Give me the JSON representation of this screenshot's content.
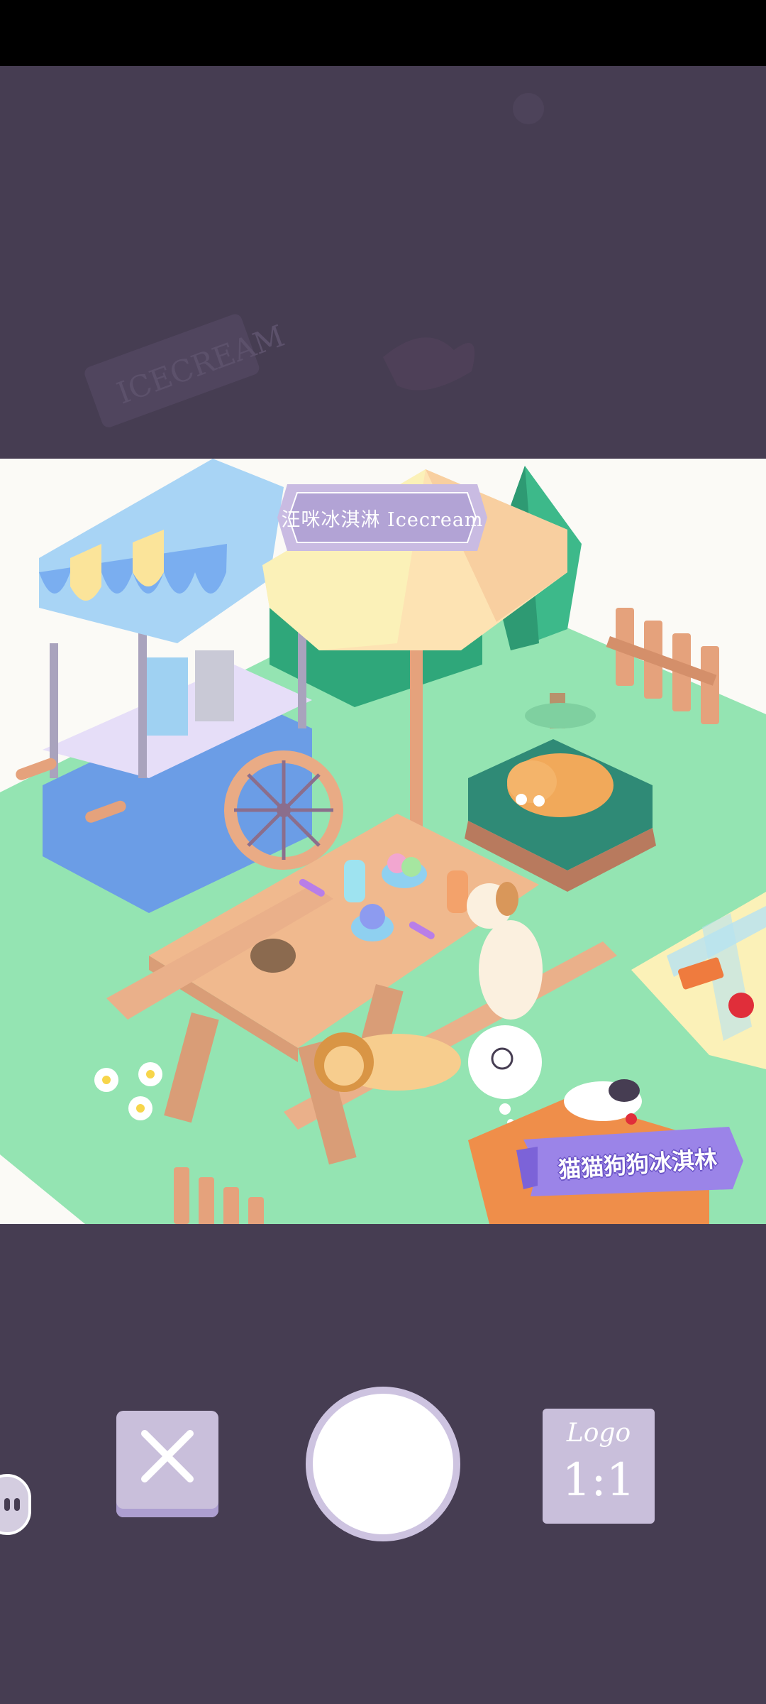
{
  "scene": {
    "shop_sign": "汪咪冰淇淋 Icecream",
    "brand_banner": "猫猫狗狗冰淇林",
    "background_sign_text": "ICECREAM"
  },
  "controls": {
    "close_icon": "close-x-icon",
    "shutter_label": "",
    "logo_label": "Logo",
    "ratio_label": "1:1"
  },
  "colors": {
    "backdrop": "#463d52",
    "grass": "#94e4b2",
    "button": "#c9bfdb",
    "banner": "#9b84e8"
  }
}
